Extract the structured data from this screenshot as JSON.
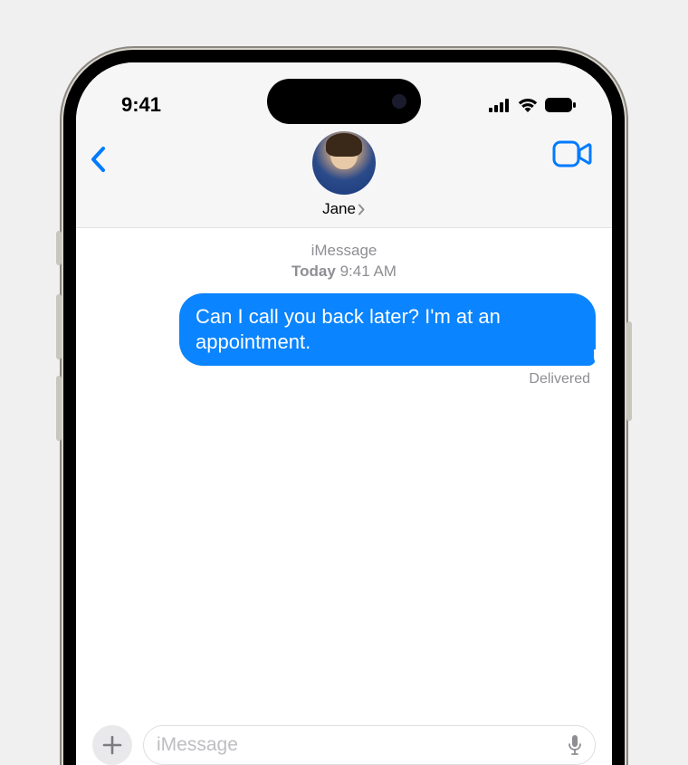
{
  "status_bar": {
    "time": "9:41"
  },
  "header": {
    "contact_name": "Jane"
  },
  "thread": {
    "service_label": "iMessage",
    "timestamp_day": "Today",
    "timestamp_time": "9:41 AM"
  },
  "messages": [
    {
      "text": "Can I call you back later? I'm at an appointment.",
      "sent": true,
      "status": "Delivered"
    }
  ],
  "compose": {
    "placeholder": "iMessage"
  }
}
